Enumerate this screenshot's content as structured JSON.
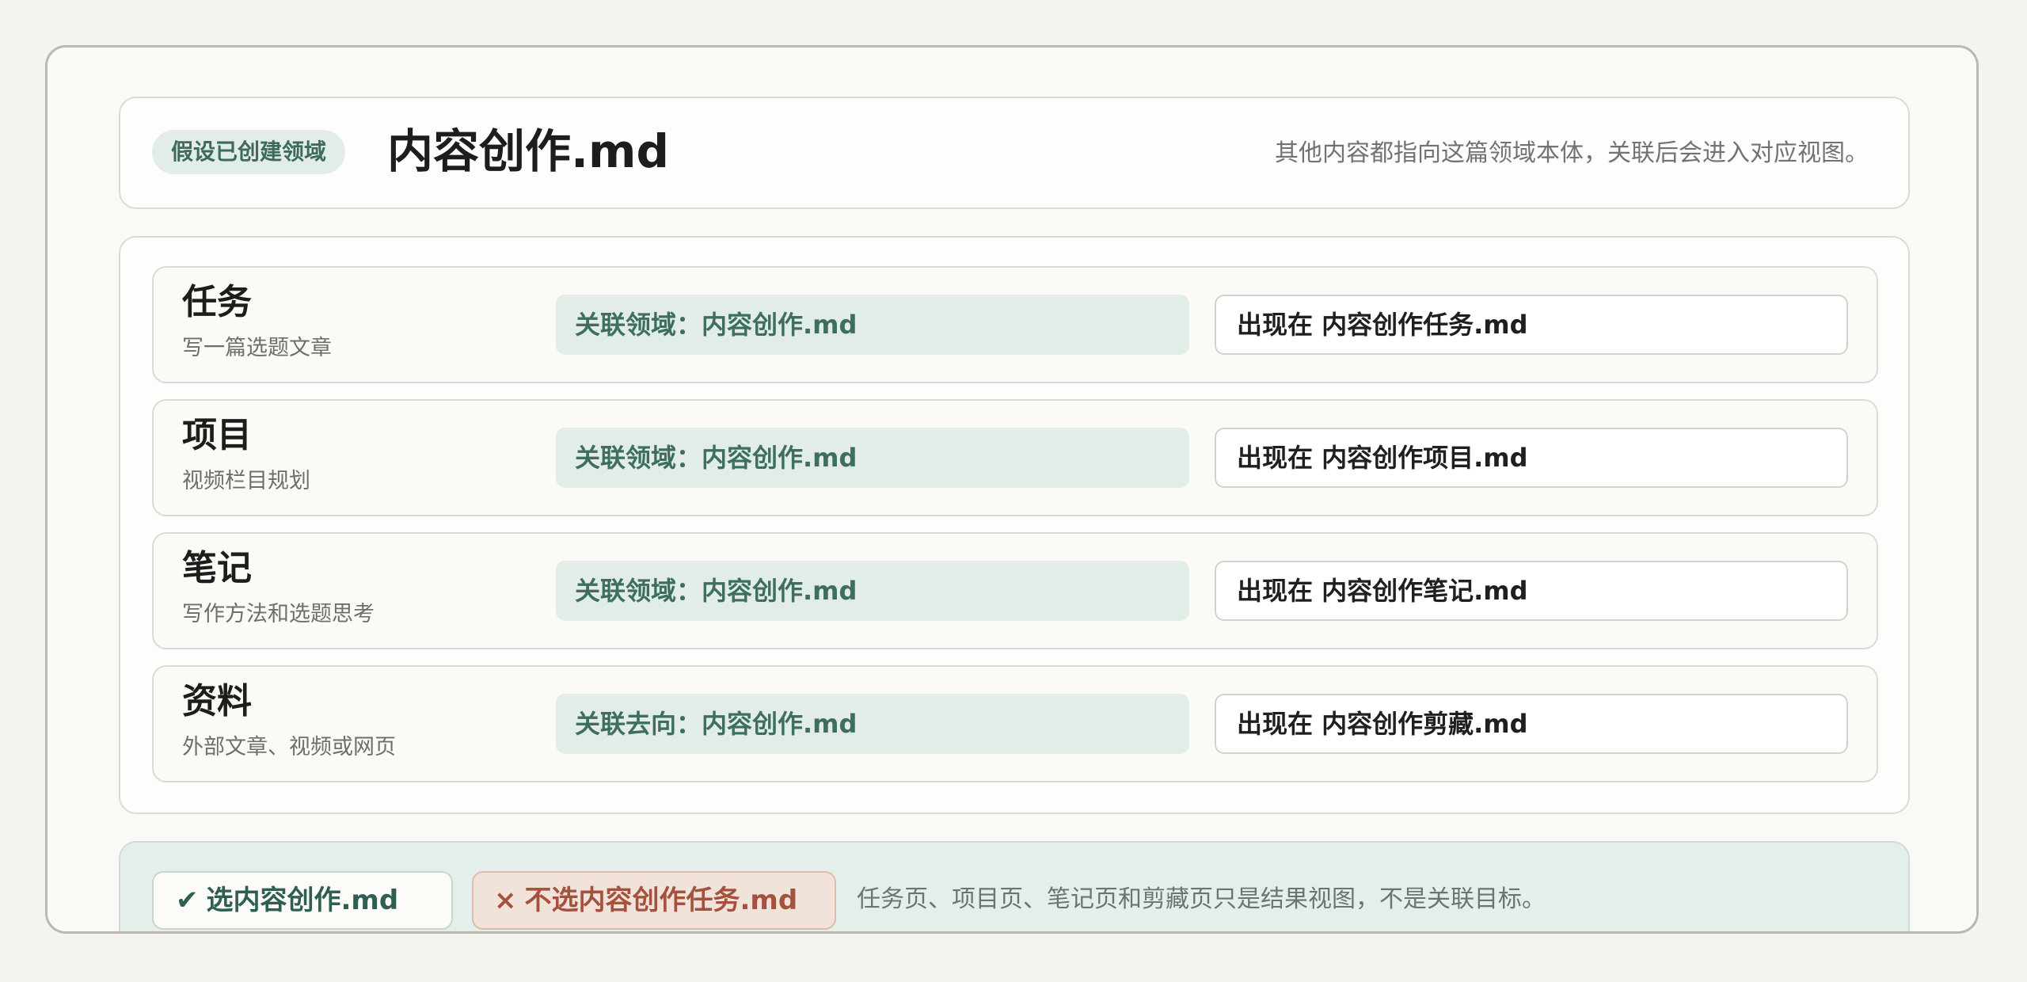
{
  "header": {
    "badge": "假设已创建领域",
    "title": "内容创作.md",
    "note": "其他内容都指向这篇领域本体，关联后会进入对应视图。"
  },
  "rows": [
    {
      "title": "任务",
      "subtitle": "写一篇选题文章",
      "link": "关联领域：内容创作.md",
      "appears": "出现在 内容创作任务.md"
    },
    {
      "title": "项目",
      "subtitle": "视频栏目规划",
      "link": "关联领域：内容创作.md",
      "appears": "出现在 内容创作项目.md"
    },
    {
      "title": "笔记",
      "subtitle": "写作方法和选题思考",
      "link": "关联领域：内容创作.md",
      "appears": "出现在 内容创作笔记.md"
    },
    {
      "title": "资料",
      "subtitle": "外部文章、视频或网页",
      "link": "关联去向：内容创作.md",
      "appears": "出现在 内容创作剪藏.md"
    }
  ],
  "footer": {
    "select_label": "选内容创作.md",
    "select_icon": "check-icon",
    "reject_label": "不选内容创作任务.md",
    "reject_icon": "cross-icon",
    "note": "任务页、项目页、笔记页和剪藏页只是结果视图，不是关联目标。"
  },
  "colors": {
    "accent_green": "#3d6e60",
    "reject_red": "#a4523d",
    "background": "#f4f3ef"
  }
}
